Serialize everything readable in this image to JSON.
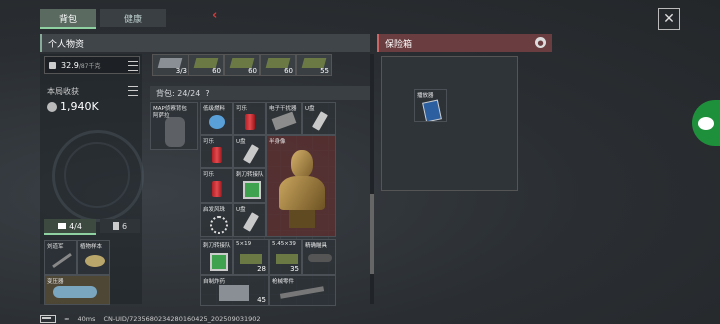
{
  "tabs": [
    {
      "label": "背包",
      "active": true
    },
    {
      "label": "健康",
      "active": false
    }
  ],
  "back_icon": "chevron-left-icon",
  "close_icon": "close-icon",
  "personal": {
    "title": "个人物资",
    "weight_current": "32.9",
    "weight_max": "/87千克",
    "earnings_label": "本局收获",
    "earnings_value": "1,940K",
    "bag_tab_count": "4/4",
    "secure_tab_count": "6"
  },
  "ammo": [
    "3/3",
    "60",
    "60",
    "60",
    "55"
  ],
  "backpack": {
    "label": "背包: 24/24",
    "help": "?",
    "bag_name": "MAP侦察背包",
    "bag_sub": "阿萨拉"
  },
  "items": [
    {
      "name": "低级燃料",
      "count": ""
    },
    {
      "name": "可乐",
      "count": ""
    },
    {
      "name": "电子干扰器",
      "count": ""
    },
    {
      "name": "U盘",
      "count": ""
    },
    {
      "name": "可乐",
      "count": ""
    },
    {
      "name": "U盘",
      "count": ""
    },
    {
      "name": "半身像",
      "count": ""
    },
    {
      "name": "可乐",
      "count": ""
    },
    {
      "name": "刺刀转接队",
      "count": ""
    },
    {
      "name": "启发风珠",
      "count": ""
    },
    {
      "name": "U盘",
      "count": ""
    },
    {
      "name": "刺刀转接队",
      "count": ""
    },
    {
      "name": "5×19",
      "count": "28"
    },
    {
      "name": "5.45×39",
      "count": "35"
    },
    {
      "name": "精确瞄具",
      "count": ""
    },
    {
      "name": "自制炸药",
      "count": "45"
    },
    {
      "name": "枪械零件",
      "count": ""
    }
  ],
  "left_items": [
    {
      "name": "刘道军",
      "count": ""
    },
    {
      "name": "植物样本",
      "count": ""
    },
    {
      "name": "变压器",
      "count": ""
    }
  ],
  "safe": {
    "title": "保险箱",
    "item": "播放器"
  },
  "status": {
    "ping": "40ms",
    "uid": "CN-UID/7235680234280160425_202509031902"
  }
}
